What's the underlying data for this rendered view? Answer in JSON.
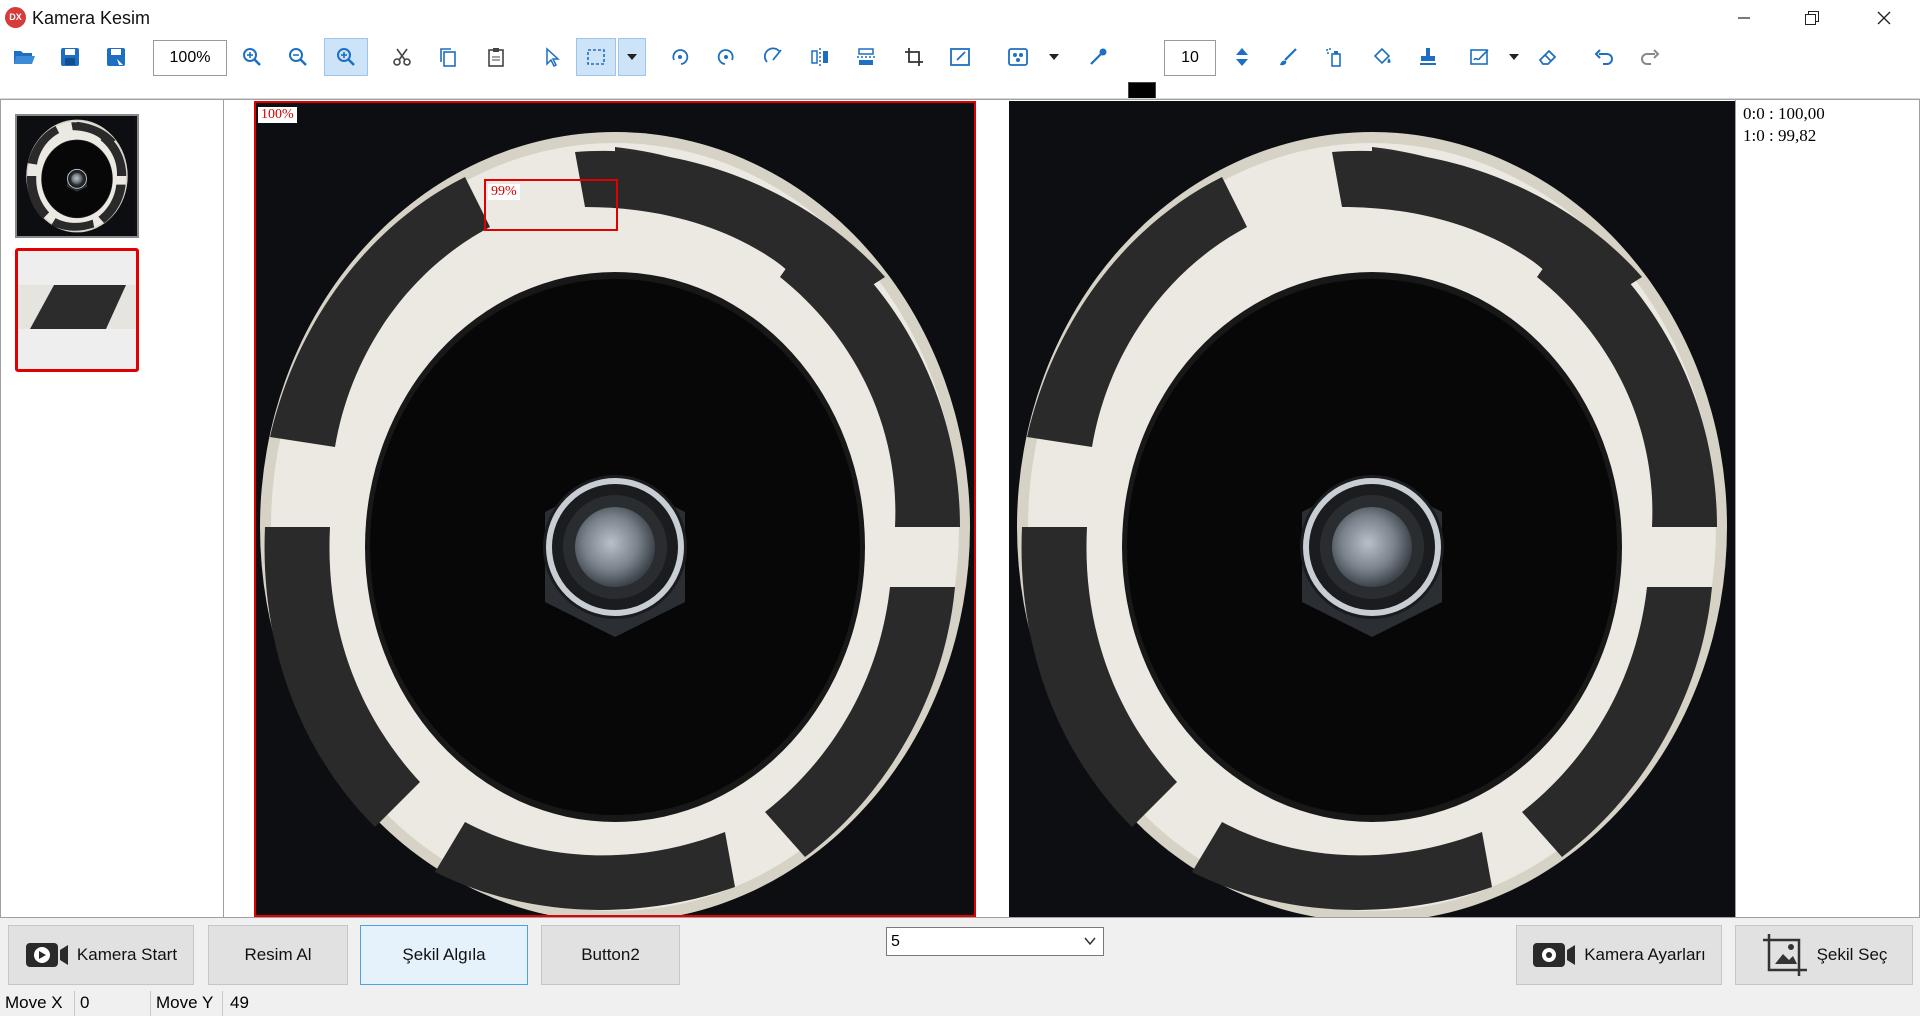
{
  "window": {
    "title": "Kamera Kesim",
    "app_icon_text": "DX"
  },
  "toolbar": {
    "zoom_value": "100%",
    "brush_size": "10",
    "color": "#000000"
  },
  "left_panel": {
    "thumbnails": [
      "full-image-thumbnail",
      "cropped-region-thumbnail"
    ]
  },
  "canvas": {
    "left_label": "100%",
    "roi_label": "99%"
  },
  "results": {
    "lines": [
      "0:0 : 100,00",
      "1:0 : 99,82"
    ]
  },
  "bottom": {
    "kamera_start": "Kamera Start",
    "resim_al": "Resim Al",
    "sekil_algila": "Şekil Algıla",
    "button2": "Button2",
    "combo_value": "5",
    "kamera_ayarlari": "Kamera Ayarları",
    "sekil_sec": "Şekil Seç"
  },
  "status": {
    "move_x_label": "Move X",
    "move_x_value": "0",
    "move_y_label": "Move Y",
    "move_y_value": "49"
  },
  "colors": {
    "accent_red": "#e00000",
    "toolbar_blue": "#1e6fc1",
    "active_bg": "#cde3f8"
  }
}
